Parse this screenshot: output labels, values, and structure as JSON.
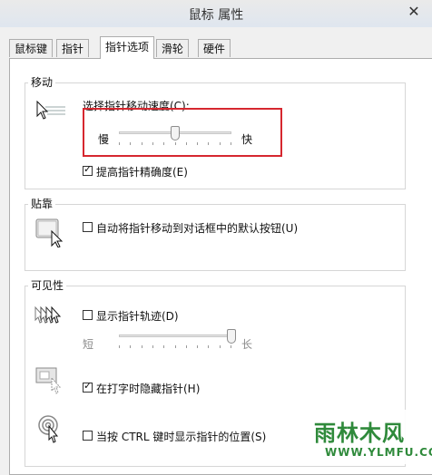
{
  "window": {
    "title": "鼠标 属性"
  },
  "tabs": [
    {
      "label": "鼠标键"
    },
    {
      "label": "指针"
    },
    {
      "label": "指针选项"
    },
    {
      "label": "滑轮"
    },
    {
      "label": "硬件"
    }
  ],
  "motion": {
    "group_label": "移动",
    "speed_label": "选择指针移动速度(C):",
    "slow_label": "慢",
    "fast_label": "快",
    "speed_level": 0.5,
    "precision_label": "提高指针精确度(E)",
    "precision_checked": true
  },
  "snap": {
    "group_label": "贴靠",
    "snap_label": "自动将指针移动到对话框中的默认按钮(U)",
    "snap_checked": false
  },
  "visibility": {
    "group_label": "可见性",
    "trails_label": "显示指针轨迹(D)",
    "trails_checked": false,
    "short_label": "短",
    "long_label": "长",
    "trail_level": 1.0,
    "hide_label": "在打字时隐藏指针(H)",
    "hide_checked": true,
    "ctrl_label": "当按 CTRL 键时显示指针的位置(S)",
    "ctrl_checked": false
  },
  "watermark": {
    "main": "雨林木风",
    "sub": "WWW.YLMFU.COM"
  }
}
